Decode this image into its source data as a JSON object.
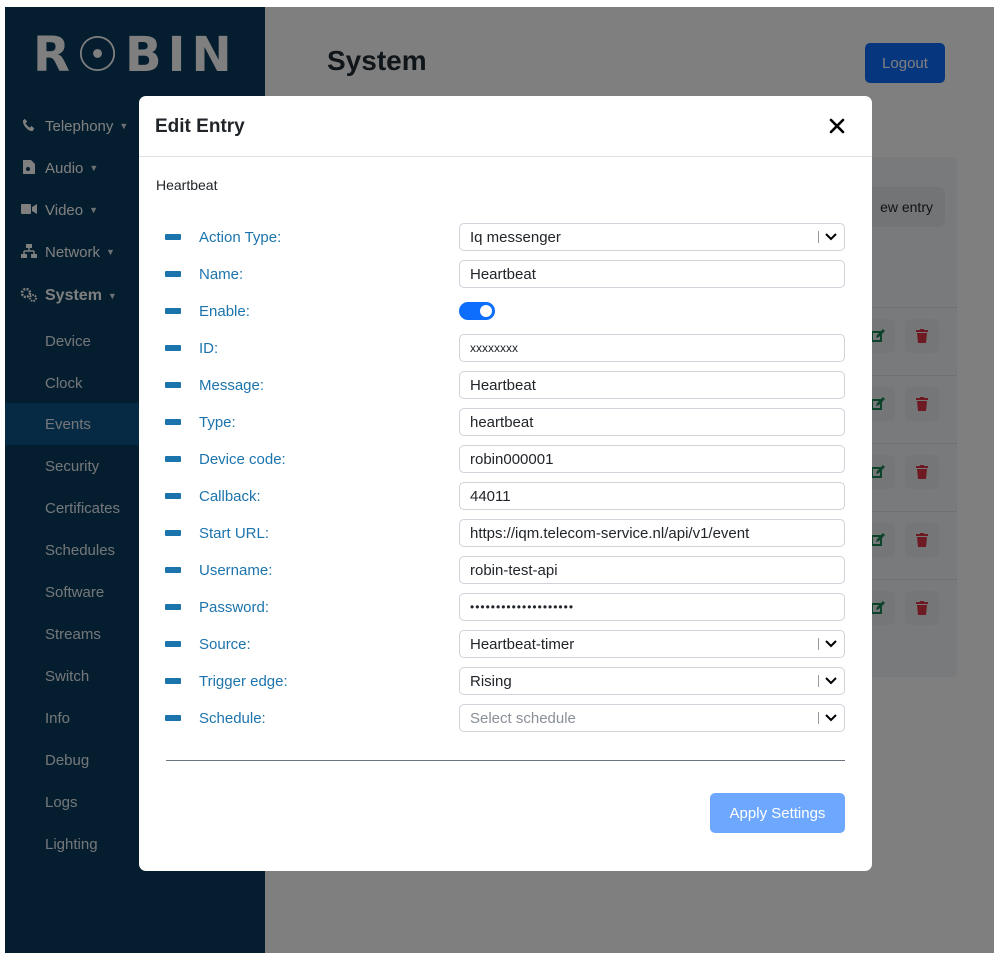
{
  "app": {
    "logo": "R☉BIN"
  },
  "sidebar": {
    "groups": [
      {
        "label": "Telephony",
        "icon": "phone-icon"
      },
      {
        "label": "Audio",
        "icon": "audio-file-icon"
      },
      {
        "label": "Video",
        "icon": "video-camera-icon"
      },
      {
        "label": "Network",
        "icon": "network-icon"
      },
      {
        "label": "System",
        "icon": "gears-icon"
      }
    ],
    "system_items": [
      "Device",
      "Clock",
      "Events",
      "Security",
      "Certificates",
      "Schedules",
      "Software",
      "Streams",
      "Switch",
      "Info",
      "Debug",
      "Logs",
      "Lighting"
    ],
    "active_item": "Events"
  },
  "header": {
    "title": "System",
    "logout_label": "Logout"
  },
  "list": {
    "new_entry_label": "ew entry"
  },
  "colors": {
    "sidebar_bg": "#0a3c5e",
    "active_item": "#0f5589",
    "primary": "#0d6efd",
    "label": "#1c74ad",
    "edit_icon": "#198754",
    "delete_icon": "#dc3545"
  },
  "modal": {
    "title": "Edit Entry",
    "section_title": "Heartbeat",
    "fields": {
      "action_type": {
        "label": "Action Type:",
        "value": "Iq messenger"
      },
      "name": {
        "label": "Name:",
        "value": "Heartbeat"
      },
      "enable": {
        "label": "Enable:",
        "value": "on"
      },
      "id": {
        "label": "ID:",
        "value": "xxxxxxxx"
      },
      "message": {
        "label": "Message:",
        "value": "Heartbeat"
      },
      "type": {
        "label": "Type:",
        "value": "heartbeat"
      },
      "device_code": {
        "label": "Device code:",
        "value": "robin000001"
      },
      "callback": {
        "label": "Callback:",
        "value": "44011"
      },
      "start_url": {
        "label": "Start URL:",
        "value": "https://iqm.telecom-service.nl/api/v1/event"
      },
      "username": {
        "label": "Username:",
        "value": "robin-test-api"
      },
      "password": {
        "label": "Password:",
        "value": "••••••••••••••••••••"
      },
      "source": {
        "label": "Source:",
        "value": "Heartbeat-timer"
      },
      "trigger_edge": {
        "label": "Trigger edge:",
        "value": "Rising"
      },
      "schedule": {
        "label": "Schedule:",
        "placeholder": "Select schedule"
      }
    },
    "apply_label": "Apply Settings"
  }
}
